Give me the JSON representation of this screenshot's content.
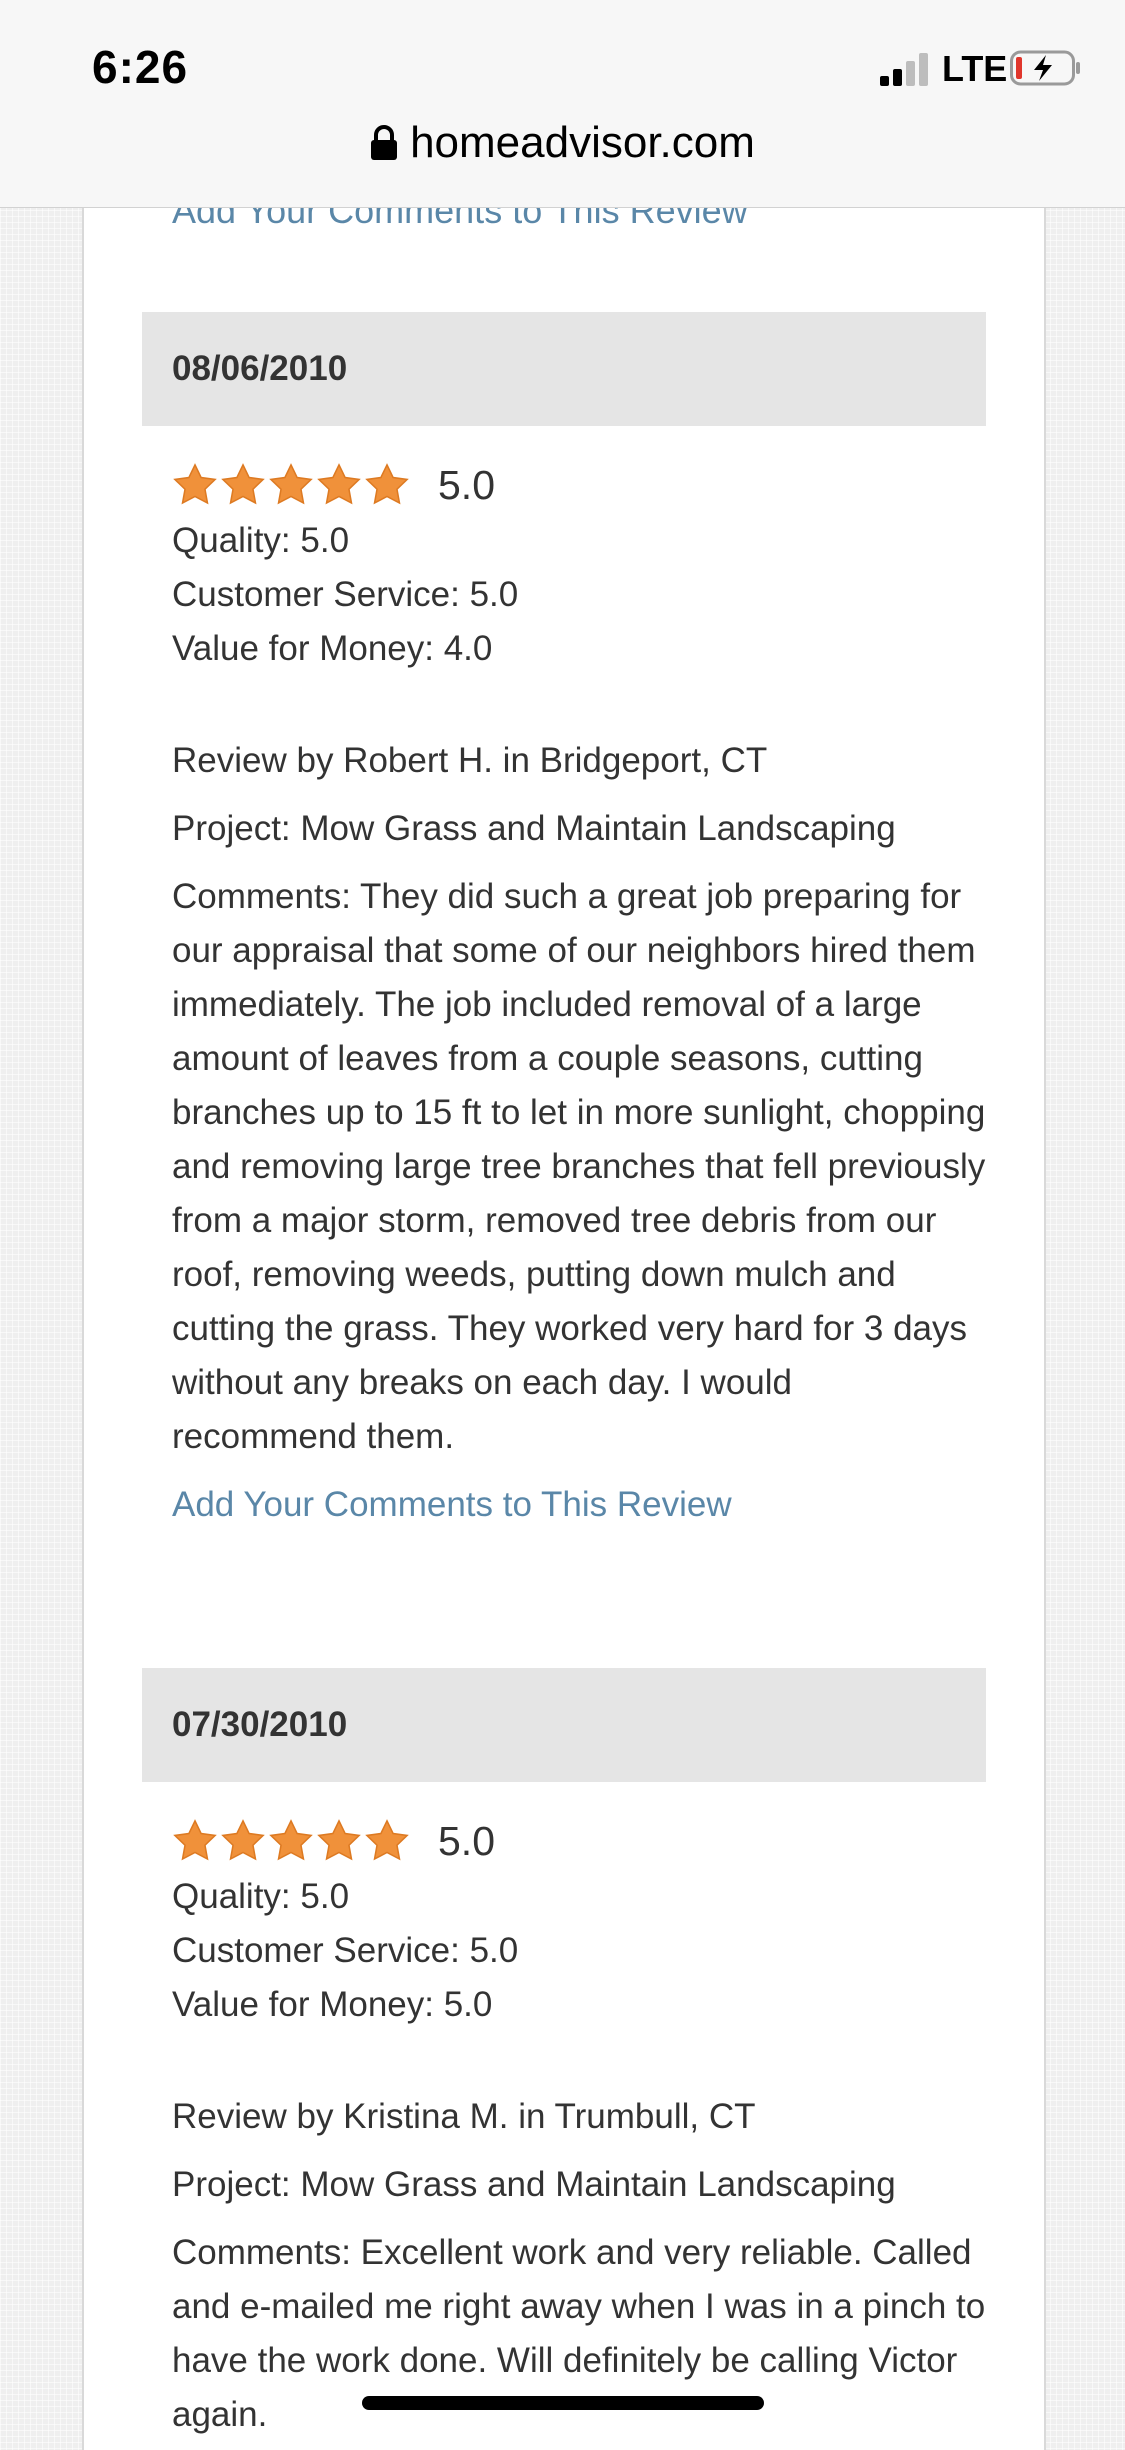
{
  "status_bar": {
    "time": "6:26",
    "network": "LTE"
  },
  "url_bar": {
    "domain": "homeadvisor.com"
  },
  "prev_review": {
    "add_comments_label": "Add Your Comments to This Review"
  },
  "reviews": [
    {
      "date": "08/06/2010",
      "rating": "5.0",
      "stars": 5,
      "quality": "Quality: 5.0",
      "customer_service": "Customer Service: 5.0",
      "value": "Value for Money: 4.0",
      "reviewer": "Review by Robert H. in Bridgeport, CT",
      "project": "Project: Mow Grass and Maintain Landscaping",
      "comments": "Comments: They did such a great job preparing for our appraisal that some of our neighbors hired them immediately. The job included removal of a large amount of leaves from a couple seasons, cutting branches up to 15 ft to let in more sunlight, chopping and removing large tree branches that fell previously from a major storm, removed tree debris from our roof, removing weeds, putting down mulch and cutting the grass. They worked very hard for 3 days without any breaks on each day. I would recommend them.",
      "add_comments_label": "Add Your Comments to This Review"
    },
    {
      "date": "07/30/2010",
      "rating": "5.0",
      "stars": 5,
      "quality": "Quality: 5.0",
      "customer_service": "Customer Service: 5.0",
      "value": "Value for Money: 5.0",
      "reviewer": "Review by Kristina M. in Trumbull, CT",
      "project": "Project: Mow Grass and Maintain Landscaping",
      "comments": "Comments: Excellent work and very reliable. Called and e-mailed me right away when I was in a pinch to have the work done. Will definitely be calling Victor again."
    }
  ],
  "colors": {
    "star": "#f0913a",
    "link": "#5a87a8",
    "date_bar": "#e5e5e5"
  }
}
